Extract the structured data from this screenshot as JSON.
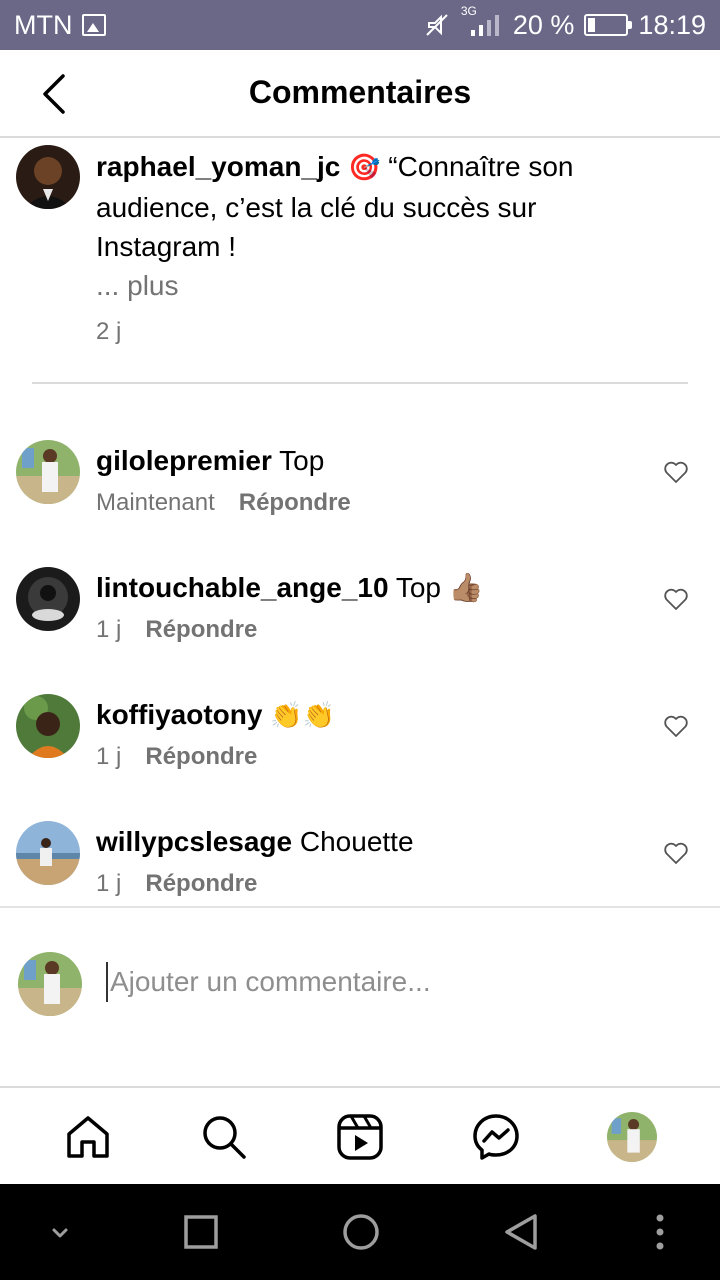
{
  "status_bar": {
    "carrier": "MTN",
    "network": "3G",
    "battery": "20 %",
    "battery_level": 0.2,
    "time": "18:19"
  },
  "header": {
    "title": "Commentaires",
    "back_icon": "chevron-left-icon"
  },
  "caption": {
    "username": "raphael_yoman_jc",
    "emoji": "🎯",
    "text": "“Connaître son audience, c’est la clé du succès sur Instagram !",
    "more_label": "... plus",
    "time": "2 j"
  },
  "comments": [
    {
      "username": "gilolepremier",
      "text": "Top",
      "time": "Maintenant",
      "reply_label": "Répondre"
    },
    {
      "username": "lintouchable_ange_10",
      "text": "Top 👍🏽",
      "time": "1 j",
      "reply_label": "Répondre"
    },
    {
      "username": "koffiyaotony",
      "text": "👏👏",
      "time": "1 j",
      "reply_label": "Répondre"
    },
    {
      "username": "willypcslesage",
      "text": "Chouette",
      "time": "1 j",
      "reply_label": "Répondre"
    }
  ],
  "composer": {
    "placeholder": "Ajouter un commentaire..."
  },
  "tab_bar": {
    "items": [
      "home-icon",
      "search-icon",
      "reels-icon",
      "messenger-icon",
      "profile-avatar"
    ]
  },
  "system_nav": {
    "items": [
      "collapse-icon",
      "recents-icon",
      "home-circle-icon",
      "back-triangle-icon",
      "more-dots-icon"
    ]
  },
  "colors": {
    "status_bar": "#6a6787",
    "secondary_text": "#737373",
    "divider": "#dbdbdb"
  }
}
